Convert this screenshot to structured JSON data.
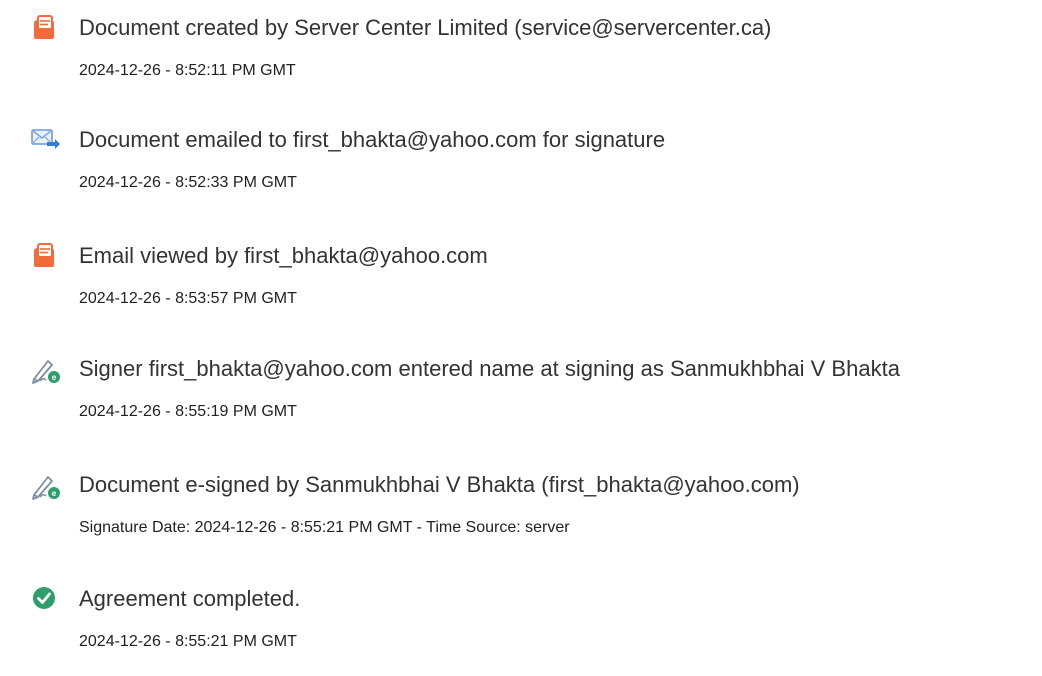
{
  "events": [
    {
      "icon": "document-icon",
      "title": "Document created by Server Center Limited (service@servercenter.ca)",
      "detail": "2024-12-26 - 8:52:11 PM GMT"
    },
    {
      "icon": "email-sent-icon",
      "title": "Document emailed to first_bhakta@yahoo.com for signature",
      "detail": "2024-12-26 - 8:52:33 PM GMT"
    },
    {
      "icon": "document-icon",
      "title": "Email viewed by first_bhakta@yahoo.com",
      "detail": "2024-12-26 - 8:53:57 PM GMT"
    },
    {
      "icon": "e-sign-pen-icon",
      "title": "Signer first_bhakta@yahoo.com entered name at signing as Sanmukhbhai V Bhakta",
      "detail": "2024-12-26 - 8:55:19 PM GMT"
    },
    {
      "icon": "e-sign-pen-icon",
      "title": "Document e-signed by Sanmukhbhai V Bhakta (first_bhakta@yahoo.com)",
      "detail": "Signature Date: 2024-12-26 - 8:55:21 PM GMT - Time Source: server"
    },
    {
      "icon": "check-circle-icon",
      "title": "Agreement completed.",
      "detail": "2024-12-26 - 8:55:21 PM GMT"
    }
  ],
  "colors": {
    "document_icon": "#f26b3a",
    "email_icon_envelope": "#7fa7de",
    "email_icon_arrow": "#2f80d6",
    "pen_icon": "#7d8fa3",
    "pen_badge": "#2e9e6a",
    "check_icon": "#2e9e6a"
  }
}
